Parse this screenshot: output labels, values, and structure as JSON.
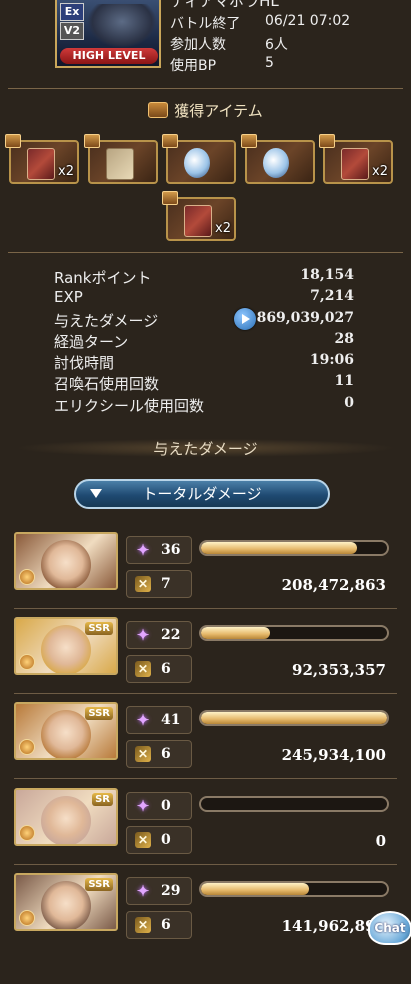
{
  "quest": {
    "title": "ティアマボラHL",
    "ex_tag": "Ex",
    "version_tag": "V2",
    "level_badge": "HIGH LEVEL",
    "info": [
      {
        "label": "バトル終了",
        "value": "06/21 07:02"
      },
      {
        "label": "参加人数",
        "value": "6人"
      },
      {
        "label": "使用BP",
        "value": "5"
      }
    ]
  },
  "items_section": {
    "title": "獲得アイテム",
    "items": [
      {
        "icon": "red-book-icon",
        "count": "x2"
      },
      {
        "icon": "scroll-icon",
        "count": ""
      },
      {
        "icon": "crystal-orb-icon",
        "count": ""
      },
      {
        "icon": "crystal-orb-icon",
        "count": ""
      },
      {
        "icon": "red-book-icon",
        "count": "x2"
      },
      {
        "icon": "red-book-icon",
        "count": "x2"
      }
    ]
  },
  "stats": [
    {
      "label": "Rankポイント",
      "value": "18,154"
    },
    {
      "label": "EXP",
      "value": "7,214"
    },
    {
      "label": "与えたダメージ",
      "value": "869,039,027"
    },
    {
      "label": "経過ターン",
      "value": "28"
    },
    {
      "label": "討伐時間",
      "value": "19:06"
    },
    {
      "label": "召喚石使用回数",
      "value": "11"
    },
    {
      "label": "エリクシール使用回数",
      "value": "0"
    }
  ],
  "damage_section": {
    "title": "与えたダメージ",
    "dropdown_label": "トータルダメージ"
  },
  "members": [
    {
      "skill": "36",
      "ougi": "7",
      "damage": "208,472,863",
      "bar": 0.84,
      "rarity": "",
      "portrait": "#8a5a3a"
    },
    {
      "skill": "22",
      "ougi": "6",
      "damage": "92,353,357",
      "bar": 0.37,
      "rarity": "SSR",
      "portrait": "#d9a94a"
    },
    {
      "skill": "41",
      "ougi": "6",
      "damage": "245,934,100",
      "bar": 1.0,
      "rarity": "SSR",
      "portrait": "#b87a3a"
    },
    {
      "skill": "0",
      "ougi": "0",
      "damage": "0",
      "bar": 0.0,
      "rarity": "SR",
      "portrait": "#c9a89a"
    },
    {
      "skill": "29",
      "ougi": "6",
      "damage": "141,962,894",
      "bar": 0.58,
      "rarity": "SSR",
      "portrait": "#7a5a48"
    }
  ],
  "chat_button": "Chat",
  "colors": {
    "background": "#2b241c",
    "gold_border": "#c8a860",
    "bar_fill": "#e5b86a",
    "button_blue": "#1f4a72"
  }
}
